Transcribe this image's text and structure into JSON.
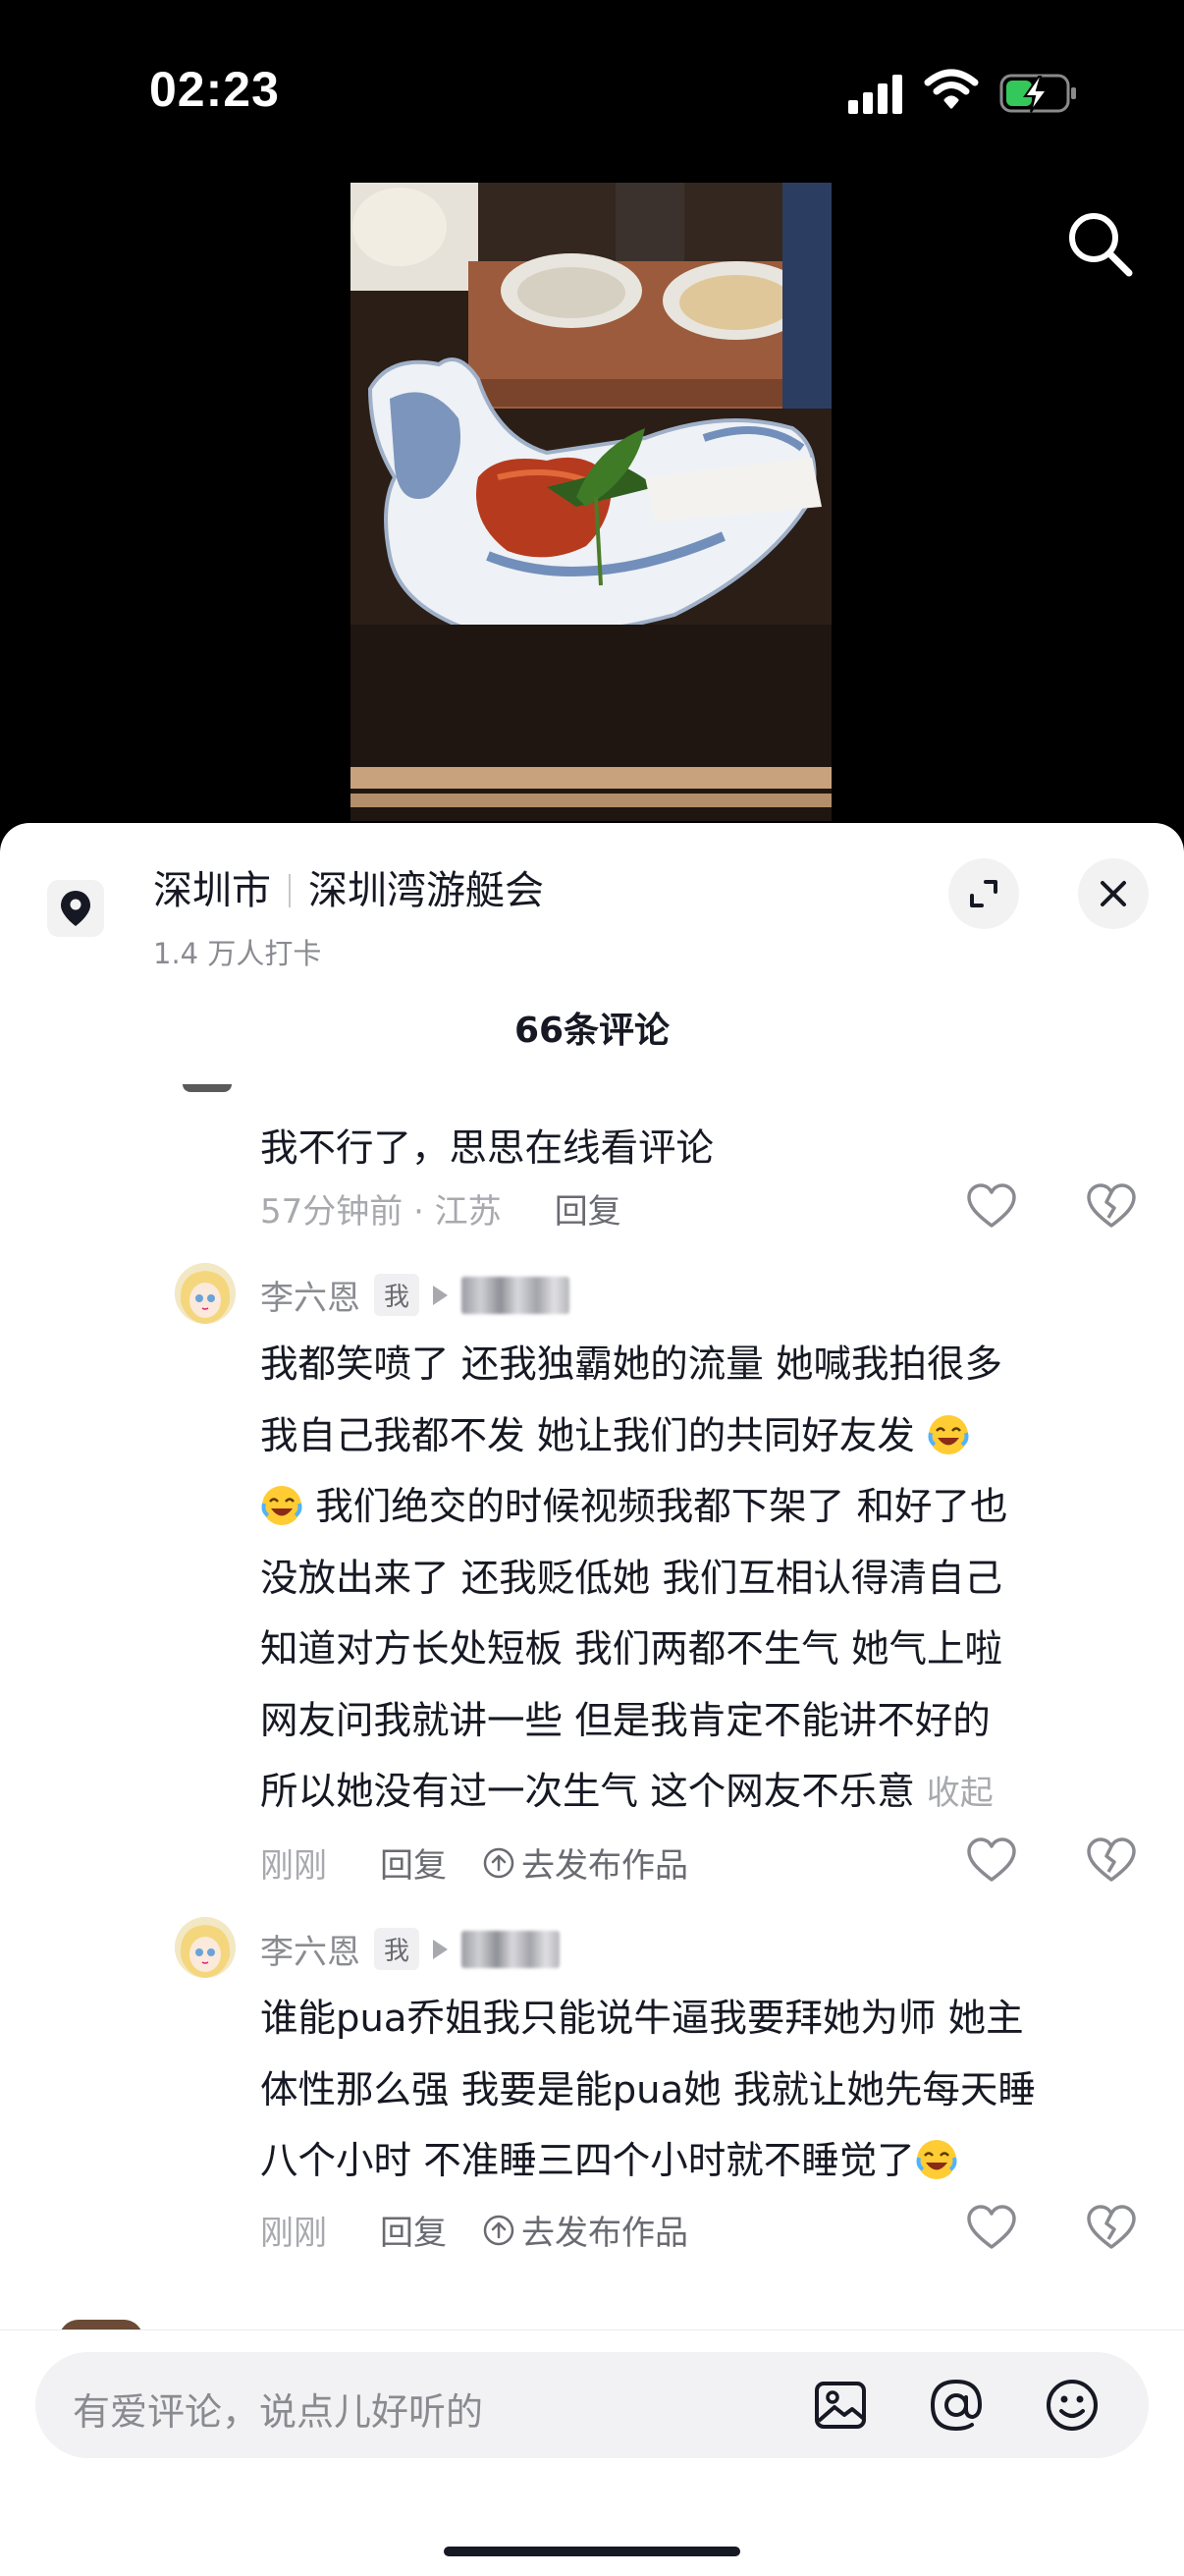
{
  "status_bar": {
    "time": "02:23",
    "icons": [
      "cellular-signal-icon",
      "wifi-icon",
      "battery-charging-icon"
    ]
  },
  "video": {
    "search_icon": "search-icon"
  },
  "location": {
    "city": "深圳市",
    "place": "深圳湾游艇会",
    "checkins": "1.4 万人打卡"
  },
  "comments_header": {
    "title": "66条评论"
  },
  "comments": [
    {
      "text_lines": [
        "我不行了，思思在线看评论"
      ],
      "time_location": "57分钟前 · 江苏",
      "reply_label": "回复"
    },
    {
      "username": "李六恩",
      "tag": "我",
      "text_lines": [
        "我都笑喷了 还我独霸她的流量 她喊我拍很多",
        "我自己我都不发 她让我们的共同好友发",
        "我们绝交的时候视频我都下架了 和好了也",
        "没放出来了 还我贬低她 我们互相认得清自己",
        "知道对方长处短板 我们两都不生气 她气上啦",
        "网友问我就讲一些 但是我肯定不能讲不好的",
        "所以她没有过一次生气 这个网友不乐意"
      ],
      "collapse_label": "收起",
      "time": "刚刚",
      "reply_label": "回复",
      "publish_label": "去发布作品"
    },
    {
      "username": "李六恩",
      "tag": "我",
      "text_lines": [
        "谁能pua乔姐我只能说牛逼我要拜她为师 她主",
        "体性那么强 我要是能pua她 我就让她先每天睡",
        "八个小时 不准睡三四个小时就不睡觉了"
      ],
      "time": "刚刚",
      "reply_label": "回复",
      "publish_label": "去发布作品"
    }
  ],
  "input": {
    "placeholder": "有爱评论，说点儿好听的",
    "icons": [
      "image-icon",
      "at-icon",
      "emoji-icon"
    ]
  },
  "colors": {
    "text_primary": "#161823",
    "text_secondary": "#8a8b91",
    "sheet_bg": "#ffffff",
    "top_bg": "#000000"
  }
}
